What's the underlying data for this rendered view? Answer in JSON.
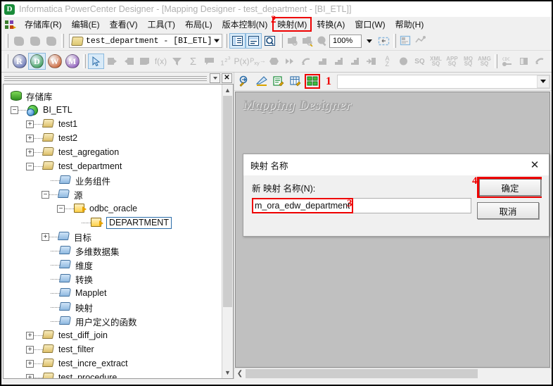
{
  "window": {
    "app_icon_letter": "D",
    "title": "Informatica PowerCenter Designer - [Mapping Designer - test_department - [BI_ETL]]"
  },
  "menubar": {
    "items": [
      {
        "label": "存储库(R)",
        "name": "menu-repository",
        "highlighted": false
      },
      {
        "label": "编辑(E)",
        "name": "menu-edit",
        "highlighted": false
      },
      {
        "label": "查看(V)",
        "name": "menu-view",
        "highlighted": false
      },
      {
        "label": "工具(T)",
        "name": "menu-tools",
        "highlighted": false
      },
      {
        "label": "布局(L)",
        "name": "menu-layout",
        "highlighted": false
      },
      {
        "label": "版本控制(N)",
        "name": "menu-version-control",
        "highlighted": false
      },
      {
        "label": "映射(M)",
        "name": "menu-mapping",
        "highlighted": true
      },
      {
        "label": "转换(A)",
        "name": "menu-transformation",
        "highlighted": false
      },
      {
        "label": "窗口(W)",
        "name": "menu-window",
        "highlighted": false
      },
      {
        "label": "帮助(H)",
        "name": "menu-help",
        "highlighted": false
      }
    ],
    "marker": "2"
  },
  "toolbar1": {
    "folder_value": "test_department - [BI_ETL]",
    "zoom_value": "100%"
  },
  "toolbar2": {
    "mode_buttons": [
      {
        "letter": "R",
        "color": "#4a5aa8",
        "name": "source-analyzer-button",
        "selected": false
      },
      {
        "letter": "D",
        "color": "#1a8c3a",
        "name": "target-designer-button",
        "selected": true
      },
      {
        "letter": "W",
        "color": "#c2450f",
        "name": "transformation-developer-button",
        "selected": false
      },
      {
        "letter": "M",
        "color": "#7a3fb0",
        "name": "mapping-designer-button",
        "selected": false
      }
    ],
    "tool_glyphs": [
      "f(x)",
      "Σ",
      "P(x)"
    ],
    "sql_labels": [
      "XML",
      "APP",
      "MQ",
      "AMG"
    ],
    "sql_sub": "SQ",
    "cdc_label": "CDC"
  },
  "tree": {
    "root_label": "存储库",
    "nodes": [
      {
        "label": "BI_ETL",
        "level": 1,
        "icon": "globe-icon",
        "expander": "-",
        "name": "tree-node-bi-etl"
      },
      {
        "label": "test1",
        "level": 2,
        "icon": "folder-yellow-icon",
        "expander": "+",
        "name": "tree-node-test1"
      },
      {
        "label": "test2",
        "level": 2,
        "icon": "folder-yellow-icon",
        "expander": "+",
        "name": "tree-node-test2"
      },
      {
        "label": "test_agregation",
        "level": 2,
        "icon": "folder-yellow-icon",
        "expander": "+",
        "name": "tree-node-test-agregation"
      },
      {
        "label": "test_department",
        "level": 2,
        "icon": "folder-yellow-icon",
        "expander": "-",
        "name": "tree-node-test-department"
      },
      {
        "label": "业务组件",
        "level": 3,
        "icon": "folder-blue-icon",
        "expander": "",
        "name": "tree-node-business-components"
      },
      {
        "label": "源",
        "level": 3,
        "icon": "folder-blue-icon",
        "expander": "-",
        "name": "tree-node-sources"
      },
      {
        "label": "odbc_oracle",
        "level": 4,
        "icon": "source-icon",
        "expander": "-",
        "name": "tree-node-odbc-oracle"
      },
      {
        "label": "DEPARTMENT",
        "level": 5,
        "icon": "source-icon",
        "expander": "",
        "selected": true,
        "name": "tree-node-department"
      },
      {
        "label": "目标",
        "level": 3,
        "icon": "folder-blue-icon",
        "expander": "+",
        "name": "tree-node-targets"
      },
      {
        "label": "多维数据集",
        "level": 3,
        "icon": "folder-blue-icon",
        "expander": "",
        "name": "tree-node-cubes"
      },
      {
        "label": "维度",
        "level": 3,
        "icon": "folder-blue-icon",
        "expander": "",
        "name": "tree-node-dimensions"
      },
      {
        "label": "转换",
        "level": 3,
        "icon": "folder-blue-icon",
        "expander": "",
        "name": "tree-node-transformations"
      },
      {
        "label": "Mapplet",
        "level": 3,
        "icon": "folder-blue-icon",
        "expander": "",
        "name": "tree-node-mapplet"
      },
      {
        "label": "映射",
        "level": 3,
        "icon": "folder-blue-icon",
        "expander": "",
        "name": "tree-node-mappings"
      },
      {
        "label": "用户定义的函数",
        "level": 3,
        "icon": "folder-blue-icon",
        "expander": "",
        "name": "tree-node-user-defined-functions"
      },
      {
        "label": "test_diff_join",
        "level": 2,
        "icon": "folder-yellow-icon",
        "expander": "+",
        "name": "tree-node-test-diff-join"
      },
      {
        "label": "test_filter",
        "level": 2,
        "icon": "folder-yellow-icon",
        "expander": "+",
        "name": "tree-node-test-filter"
      },
      {
        "label": "test_incre_extract",
        "level": 2,
        "icon": "folder-yellow-icon",
        "expander": "+",
        "name": "tree-node-test-incre-extract"
      },
      {
        "label": "test_procedure",
        "level": 2,
        "icon": "folder-yellow-icon",
        "expander": "+",
        "name": "tree-node-test-procedure"
      }
    ]
  },
  "workspace": {
    "watermark": "Mapping Designer",
    "toolbar_marker": "1"
  },
  "dialog": {
    "title": "映射 名称",
    "close_icon": "✕",
    "field_label": "新 映射 名称(N):",
    "field_value": "m_ora_edw_department",
    "field_marker": "3",
    "ok_label": "确定",
    "ok_marker": "4",
    "cancel_label": "取消"
  },
  "colors": {
    "marker_red": "#ee0000",
    "selection_blue": "#2a6ca8",
    "canvas_gray": "#c0c0c0",
    "chrome_gray": "#f0f0f0"
  }
}
